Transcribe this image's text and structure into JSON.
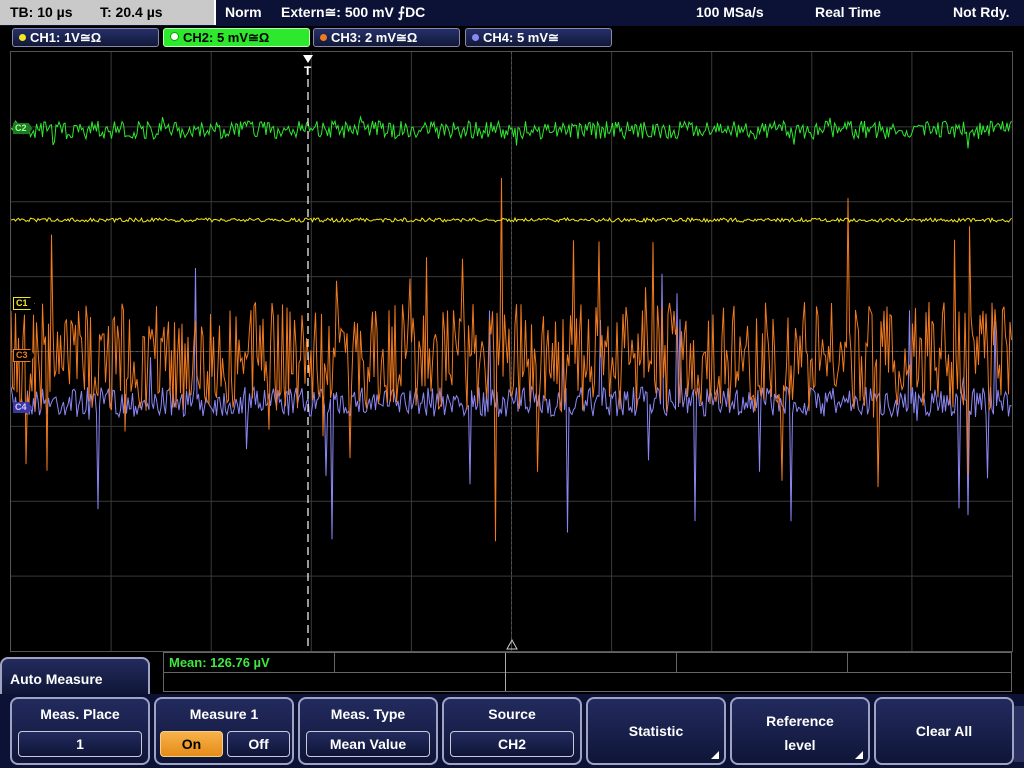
{
  "status": {
    "tb": "TB: 10 µs",
    "t": "T: 20.4 µs",
    "trigger_mode": "Norm",
    "trigger_source": "Extern≅: 500 mV ⨍DC",
    "sample_rate": "100 MSa/s",
    "acq_mode": "Real Time",
    "state": "Not Rdy."
  },
  "channels": [
    {
      "label": "CH1: 1V≅Ω",
      "color": "#f2e81e"
    },
    {
      "label": "CH2: 5 mV≅Ω",
      "color": "#2ee82e",
      "active": true
    },
    {
      "label": "CH3: 2 mV≅Ω",
      "color": "#f07a1e"
    },
    {
      "label": "CH4: 5 mV≅",
      "color": "#8c86f5"
    }
  ],
  "markers": {
    "ch2": "C2",
    "ch1": "C1",
    "ch3": "C3",
    "ch4": "C4"
  },
  "trigger_marker": "T",
  "measurement": {
    "readout": "Mean: 126.76 µV"
  },
  "menu": {
    "title": "Auto Measure",
    "meas_place": {
      "label": "Meas. Place",
      "value": "1"
    },
    "measure1": {
      "label": "Measure 1",
      "on": "On",
      "off": "Off"
    },
    "meas_type": {
      "label": "Meas. Type",
      "value": "Mean Value"
    },
    "source": {
      "label": "Source",
      "value": "CH2"
    },
    "statistic": {
      "label": "Statistic"
    },
    "reference": {
      "label1": "Reference",
      "label2": "level"
    },
    "clear_all": {
      "label": "Clear All"
    }
  }
}
